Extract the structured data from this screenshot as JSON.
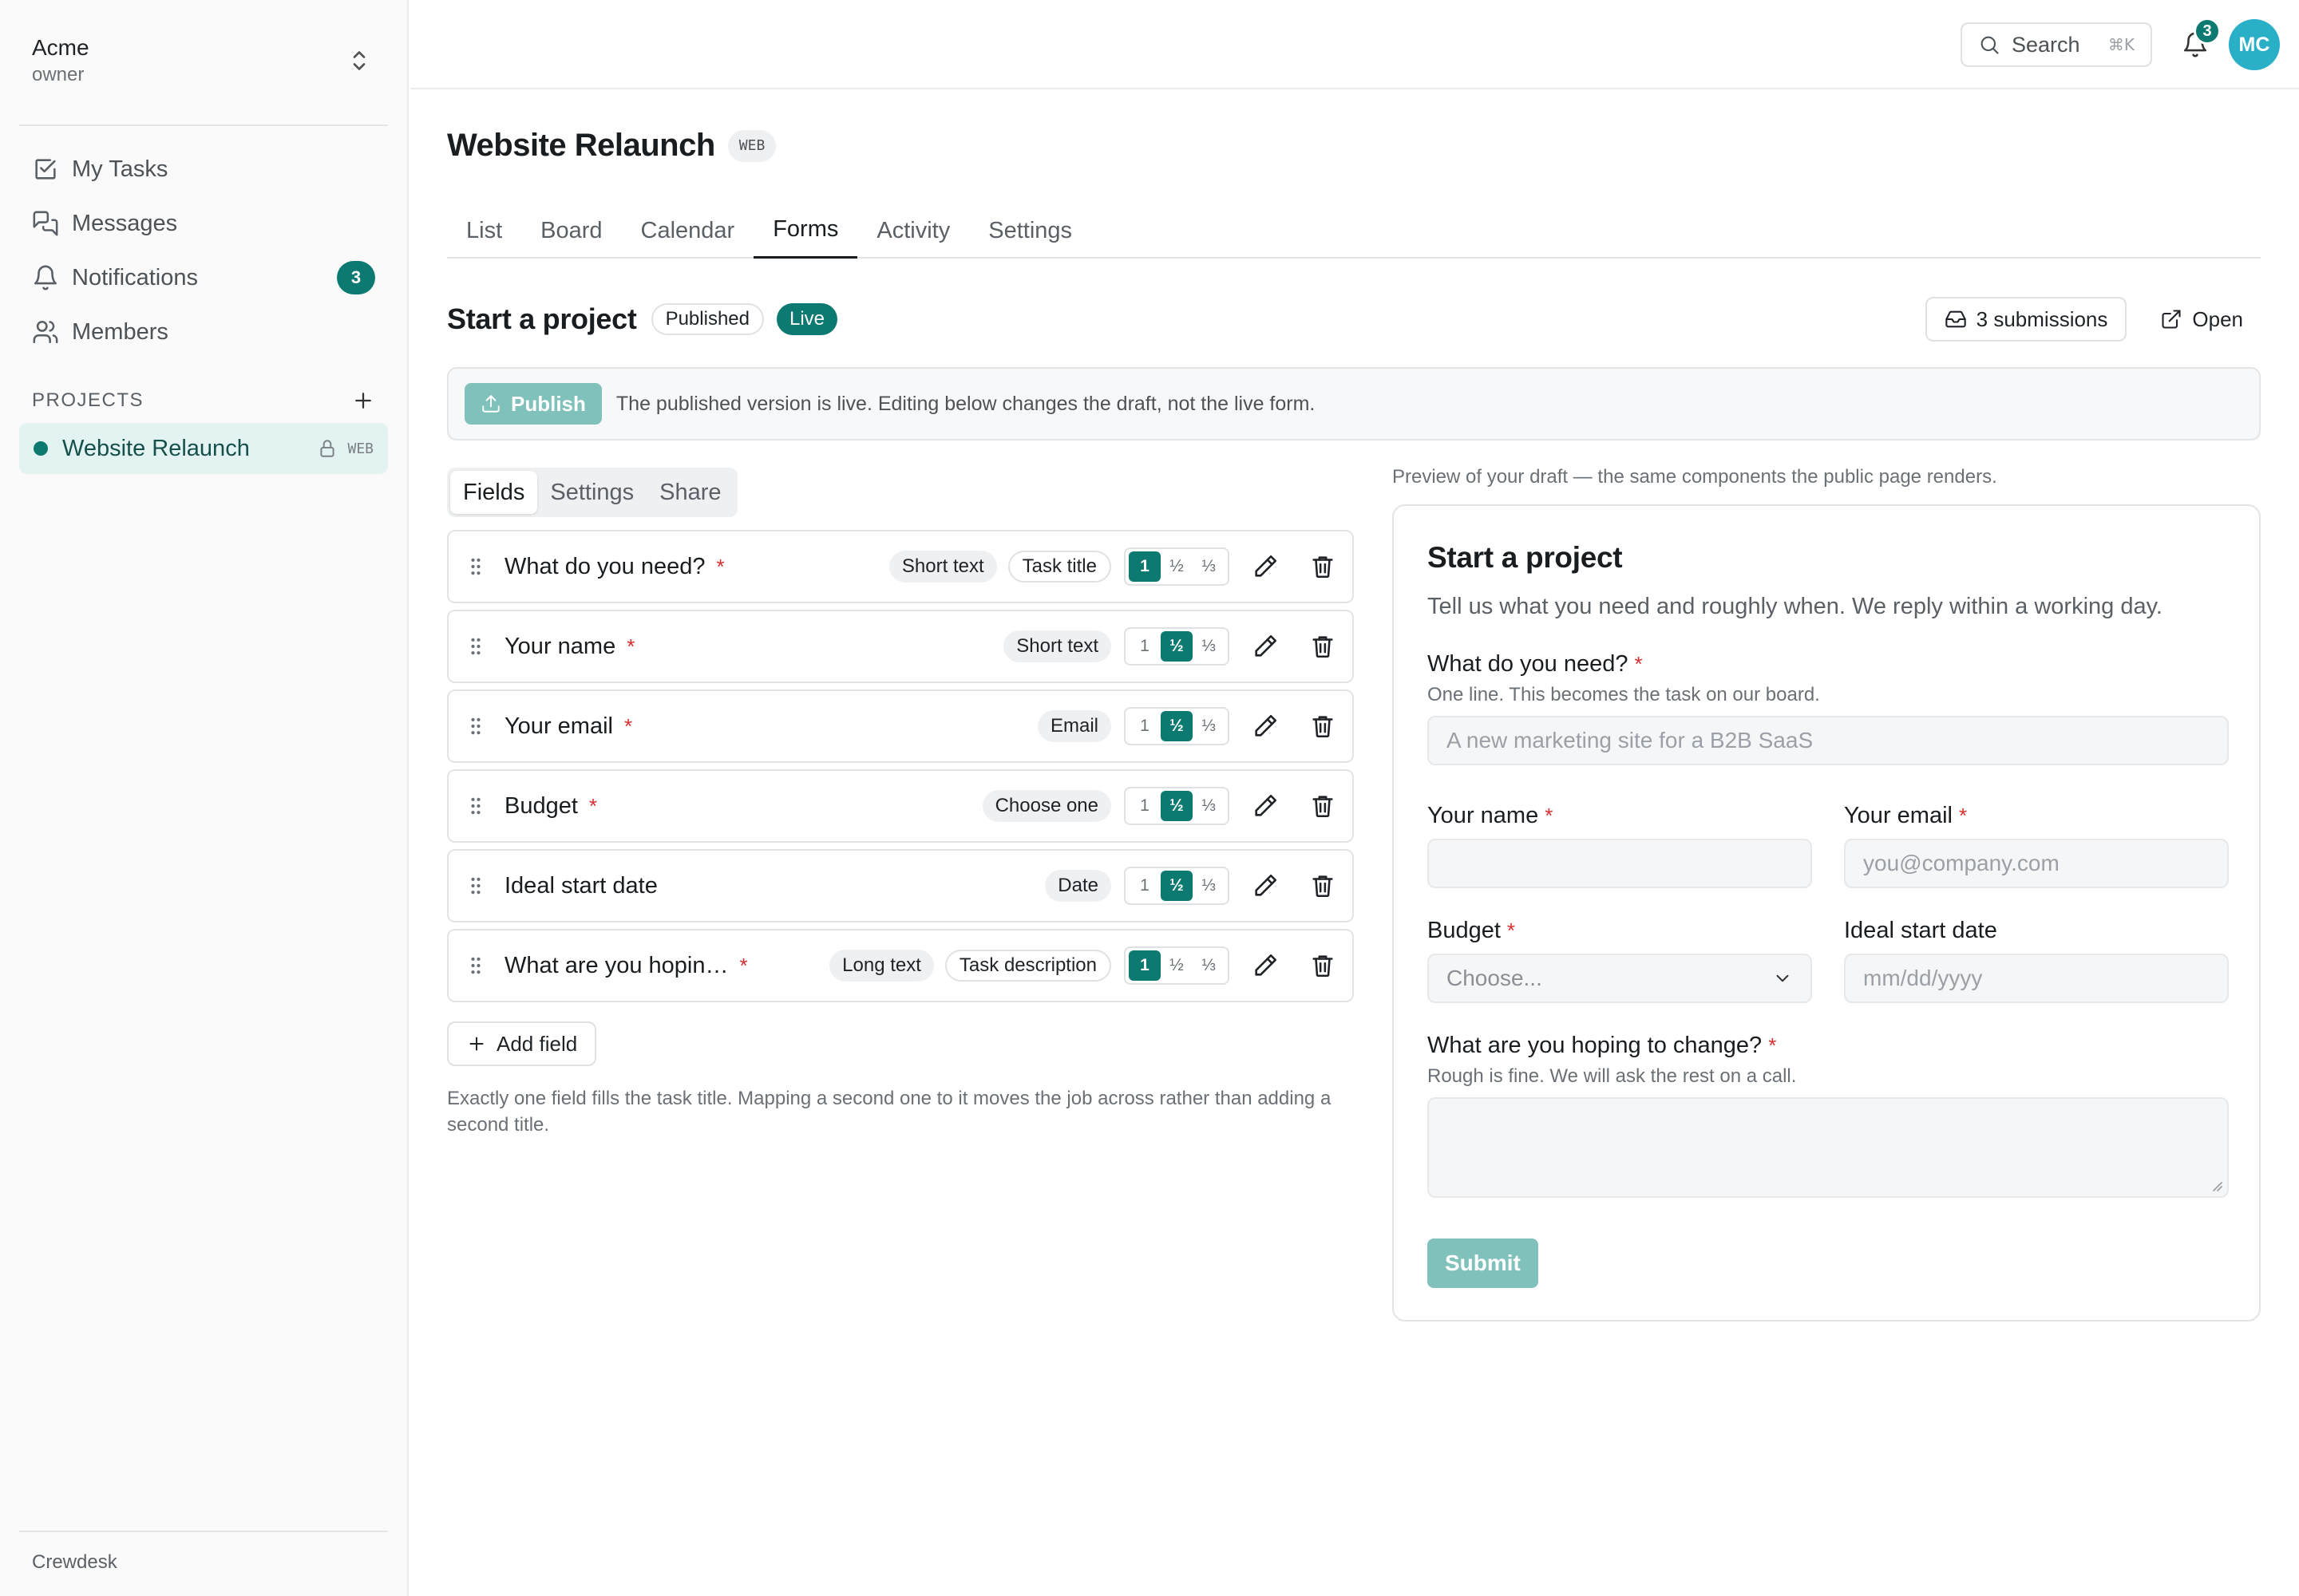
{
  "sidebar": {
    "workspace": {
      "name": "Acme",
      "role": "owner"
    },
    "nav": [
      {
        "label": "My Tasks",
        "icon": "checkbox-icon"
      },
      {
        "label": "Messages",
        "icon": "messages-icon"
      },
      {
        "label": "Notifications",
        "icon": "bell-icon",
        "badge": "3"
      },
      {
        "label": "Members",
        "icon": "users-icon"
      }
    ],
    "projects_header": "PROJECTS",
    "project": {
      "name": "Website Relaunch",
      "tag": "WEB"
    },
    "footer": "Crewdesk"
  },
  "topbar": {
    "search_label": "Search",
    "search_shortcut": "⌘K",
    "notification_count": "3",
    "avatar_initials": "MC"
  },
  "page": {
    "title": "Website Relaunch",
    "tag": "WEB",
    "tabs": [
      "List",
      "Board",
      "Calendar",
      "Forms",
      "Activity",
      "Settings"
    ],
    "active_tab": "Forms"
  },
  "form": {
    "title": "Start a project",
    "status": "Published",
    "live": "Live",
    "submissions": "3 submissions",
    "open": "Open",
    "publish_label": "Publish",
    "banner_text": "The published version is live. Editing below changes the draft, not the live form.",
    "builder_tabs": [
      "Fields",
      "Settings",
      "Share"
    ],
    "width_options": [
      "1",
      "½",
      "⅓"
    ],
    "fields": [
      {
        "label": "What do you need?",
        "required": "*",
        "type": "Short text",
        "maps": "Task title",
        "width": "1"
      },
      {
        "label": "Your name",
        "required": "*",
        "type": "Short text",
        "maps": "",
        "width": "½"
      },
      {
        "label": "Your email",
        "required": "*",
        "type": "Email",
        "maps": "",
        "width": "½"
      },
      {
        "label": "Budget",
        "required": "*",
        "type": "Choose one",
        "maps": "",
        "width": "½"
      },
      {
        "label": "Ideal start date",
        "required": "",
        "type": "Date",
        "maps": "",
        "width": "½"
      },
      {
        "label": "What are you hopin…",
        "required": "*",
        "type": "Long text",
        "maps": "Task description",
        "width": "1"
      }
    ],
    "add_field": "Add field",
    "hint": "Exactly one field fills the task title. Mapping a second one to it moves the job across rather than adding a second title."
  },
  "preview": {
    "caption": "Preview of your draft — the same components the public page renders.",
    "title": "Start a project",
    "description": "Tell us what you need and roughly when. We reply within a working day.",
    "need": {
      "label": "What do you need?",
      "help": "One line. This becomes the task on our board.",
      "placeholder": "A new marketing site for a B2B SaaS"
    },
    "name": {
      "label": "Your name"
    },
    "email": {
      "label": "Your email",
      "placeholder": "you@company.com"
    },
    "budget": {
      "label": "Budget",
      "placeholder": "Choose..."
    },
    "start_date": {
      "label": "Ideal start date",
      "placeholder": "mm/dd/yyyy"
    },
    "hoping": {
      "label": "What are you hoping to change?",
      "help": "Rough is fine. We will ask the rest on a call."
    },
    "required_mark": "*",
    "submit": "Submit"
  },
  "colors": {
    "accent": "#0d7a72",
    "accent_light": "#80c2bb",
    "required": "#d62f2f",
    "avatar": "#2ab0c6"
  }
}
